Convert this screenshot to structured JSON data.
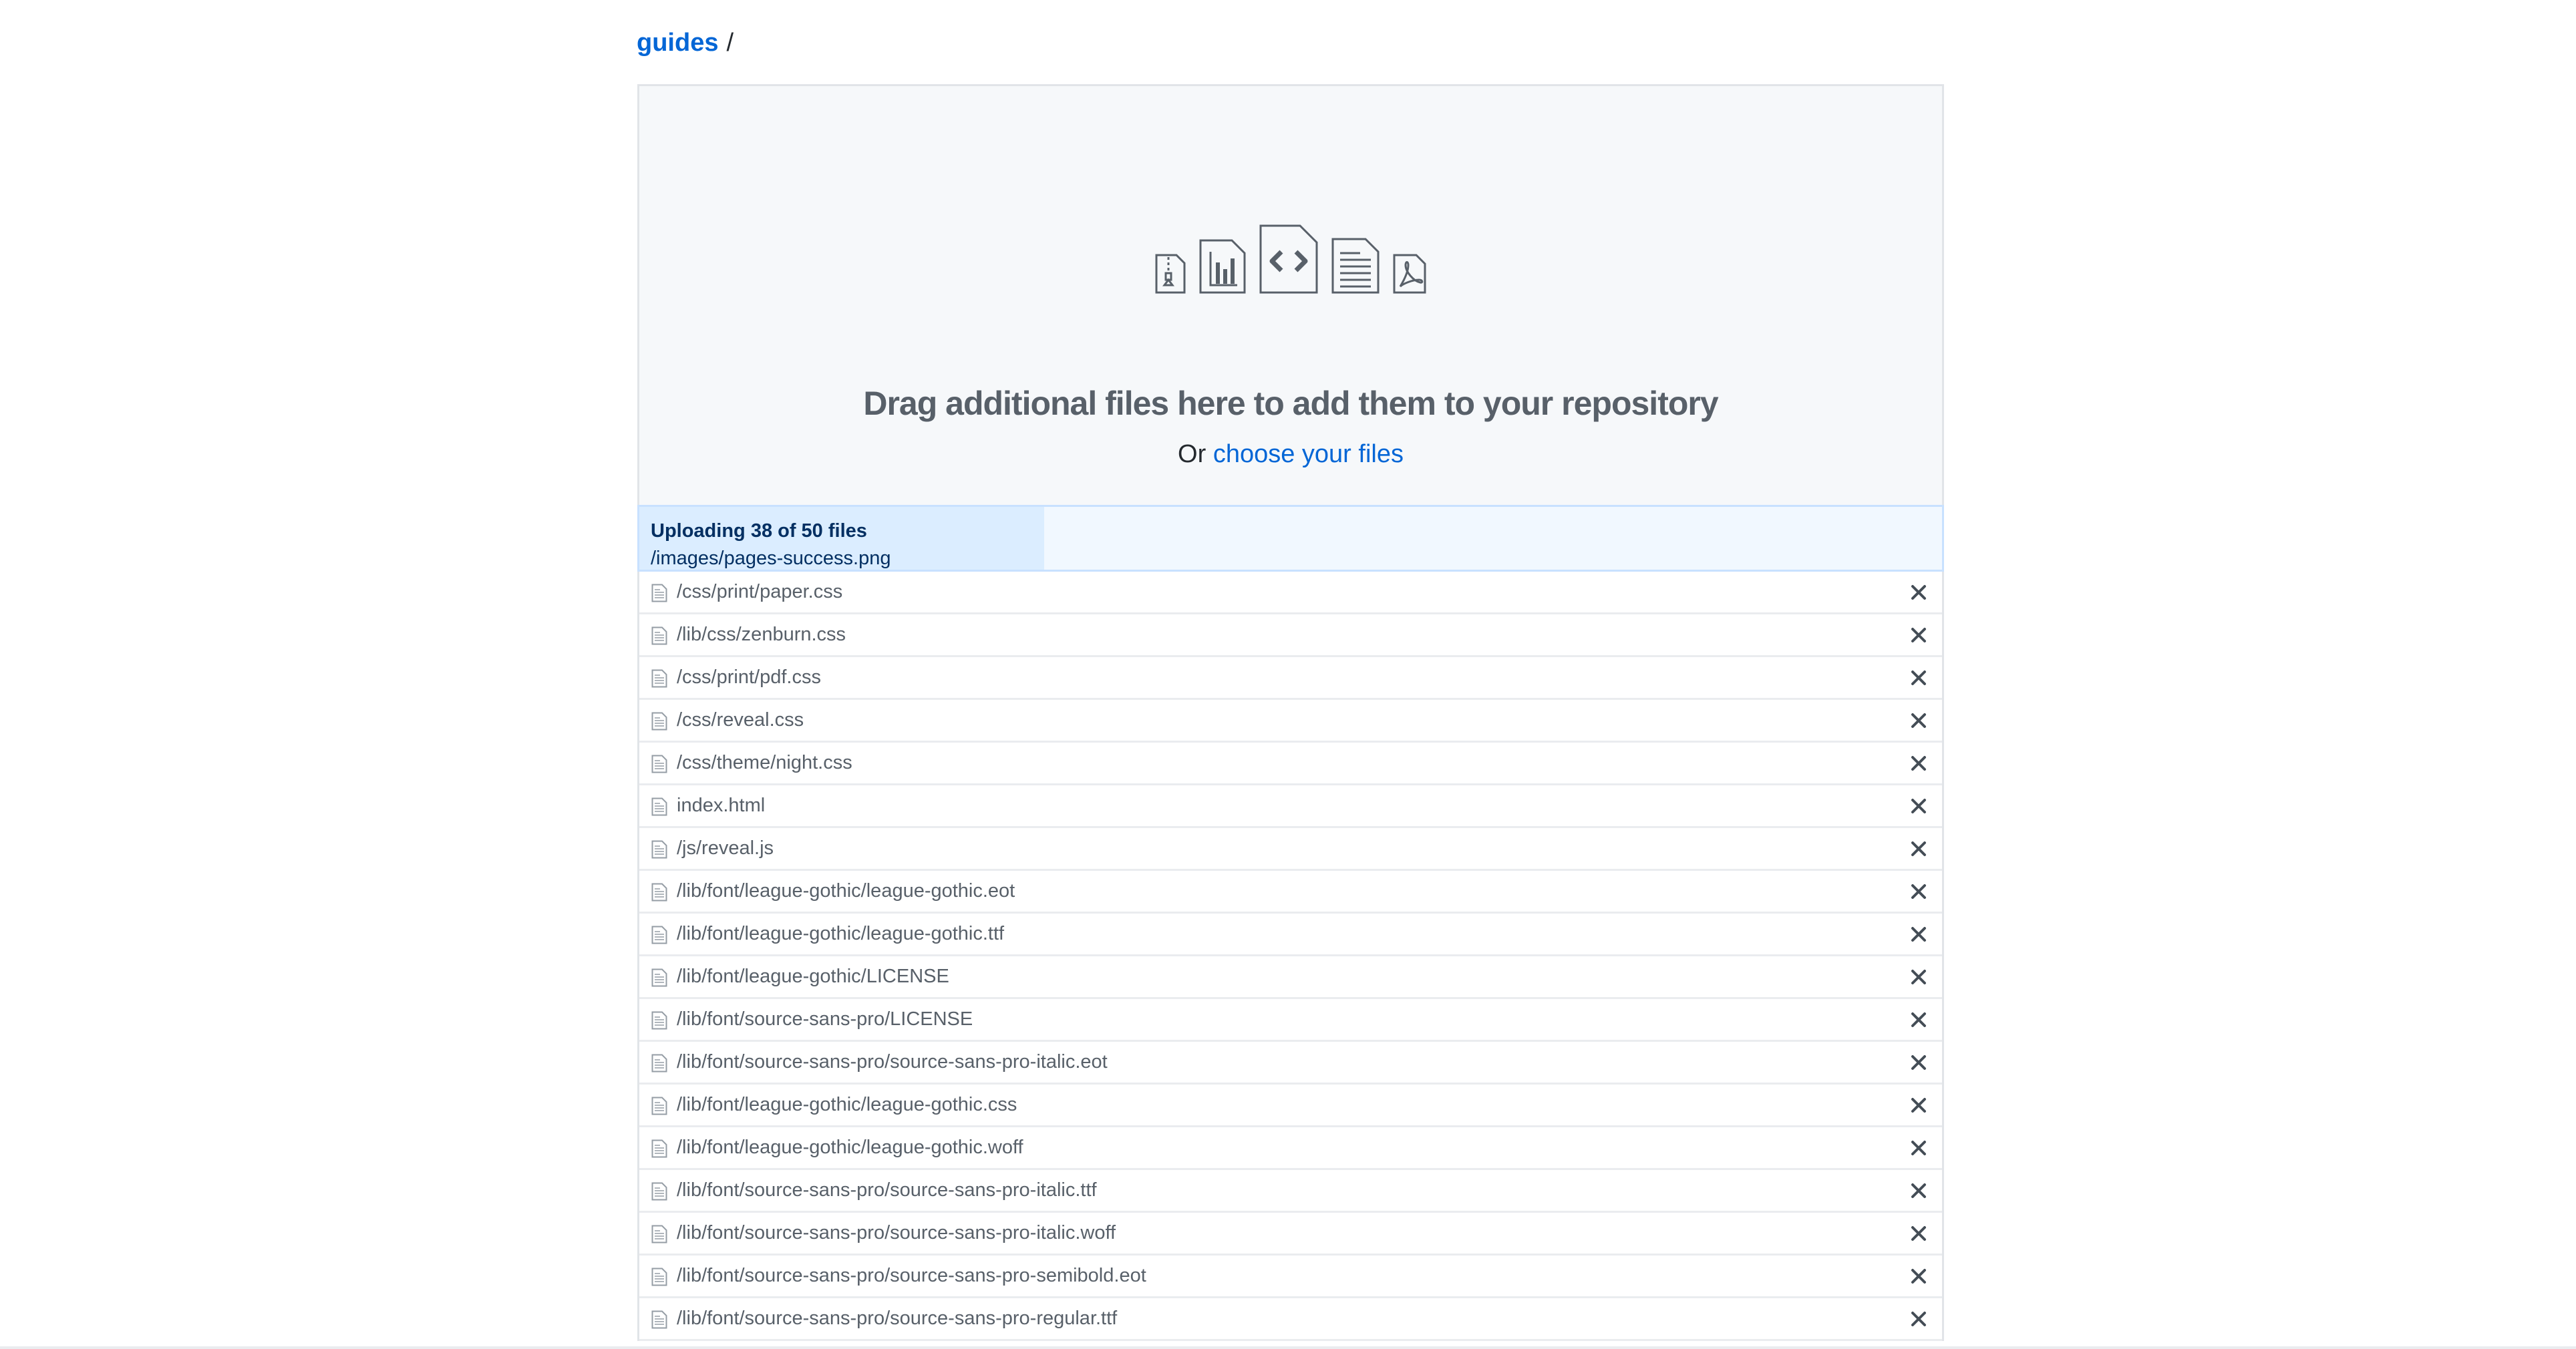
{
  "breadcrumb": {
    "repo": "guides",
    "separator": "/"
  },
  "dropzone": {
    "title": "Drag additional files here to add them to your repository",
    "prefix": "Or",
    "link": "choose your files",
    "icons": [
      "file-zip-icon",
      "file-chart-icon",
      "file-code-icon",
      "file-text-icon",
      "file-pdf-icon"
    ]
  },
  "upload": {
    "status": "Uploading 38 of 50 files",
    "current_file": "/images/pages-success.png",
    "progress_fraction": 0.311
  },
  "files": [
    {
      "name": "/css/print/paper.css"
    },
    {
      "name": "/lib/css/zenburn.css"
    },
    {
      "name": "/css/print/pdf.css"
    },
    {
      "name": "/css/reveal.css"
    },
    {
      "name": "/css/theme/night.css"
    },
    {
      "name": "index.html"
    },
    {
      "name": "/js/reveal.js"
    },
    {
      "name": "/lib/font/league-gothic/league-gothic.eot"
    },
    {
      "name": "/lib/font/league-gothic/league-gothic.ttf"
    },
    {
      "name": "/lib/font/league-gothic/LICENSE"
    },
    {
      "name": "/lib/font/source-sans-pro/LICENSE"
    },
    {
      "name": "/lib/font/source-sans-pro/source-sans-pro-italic.eot"
    },
    {
      "name": "/lib/font/league-gothic/league-gothic.css"
    },
    {
      "name": "/lib/font/league-gothic/league-gothic.woff"
    },
    {
      "name": "/lib/font/source-sans-pro/source-sans-pro-italic.ttf"
    },
    {
      "name": "/lib/font/source-sans-pro/source-sans-pro-italic.woff"
    },
    {
      "name": "/lib/font/source-sans-pro/source-sans-pro-semibold.eot"
    },
    {
      "name": "/lib/font/source-sans-pro/source-sans-pro-regular.ttf"
    }
  ],
  "icons": {
    "file_row": "file-text-icon",
    "remove": "close-icon"
  },
  "colors": {
    "link": "#0366d6",
    "progress_bg": "#f1f8ff",
    "progress_fill": "#dbedff",
    "dropzone_bg": "#f6f8fa"
  }
}
